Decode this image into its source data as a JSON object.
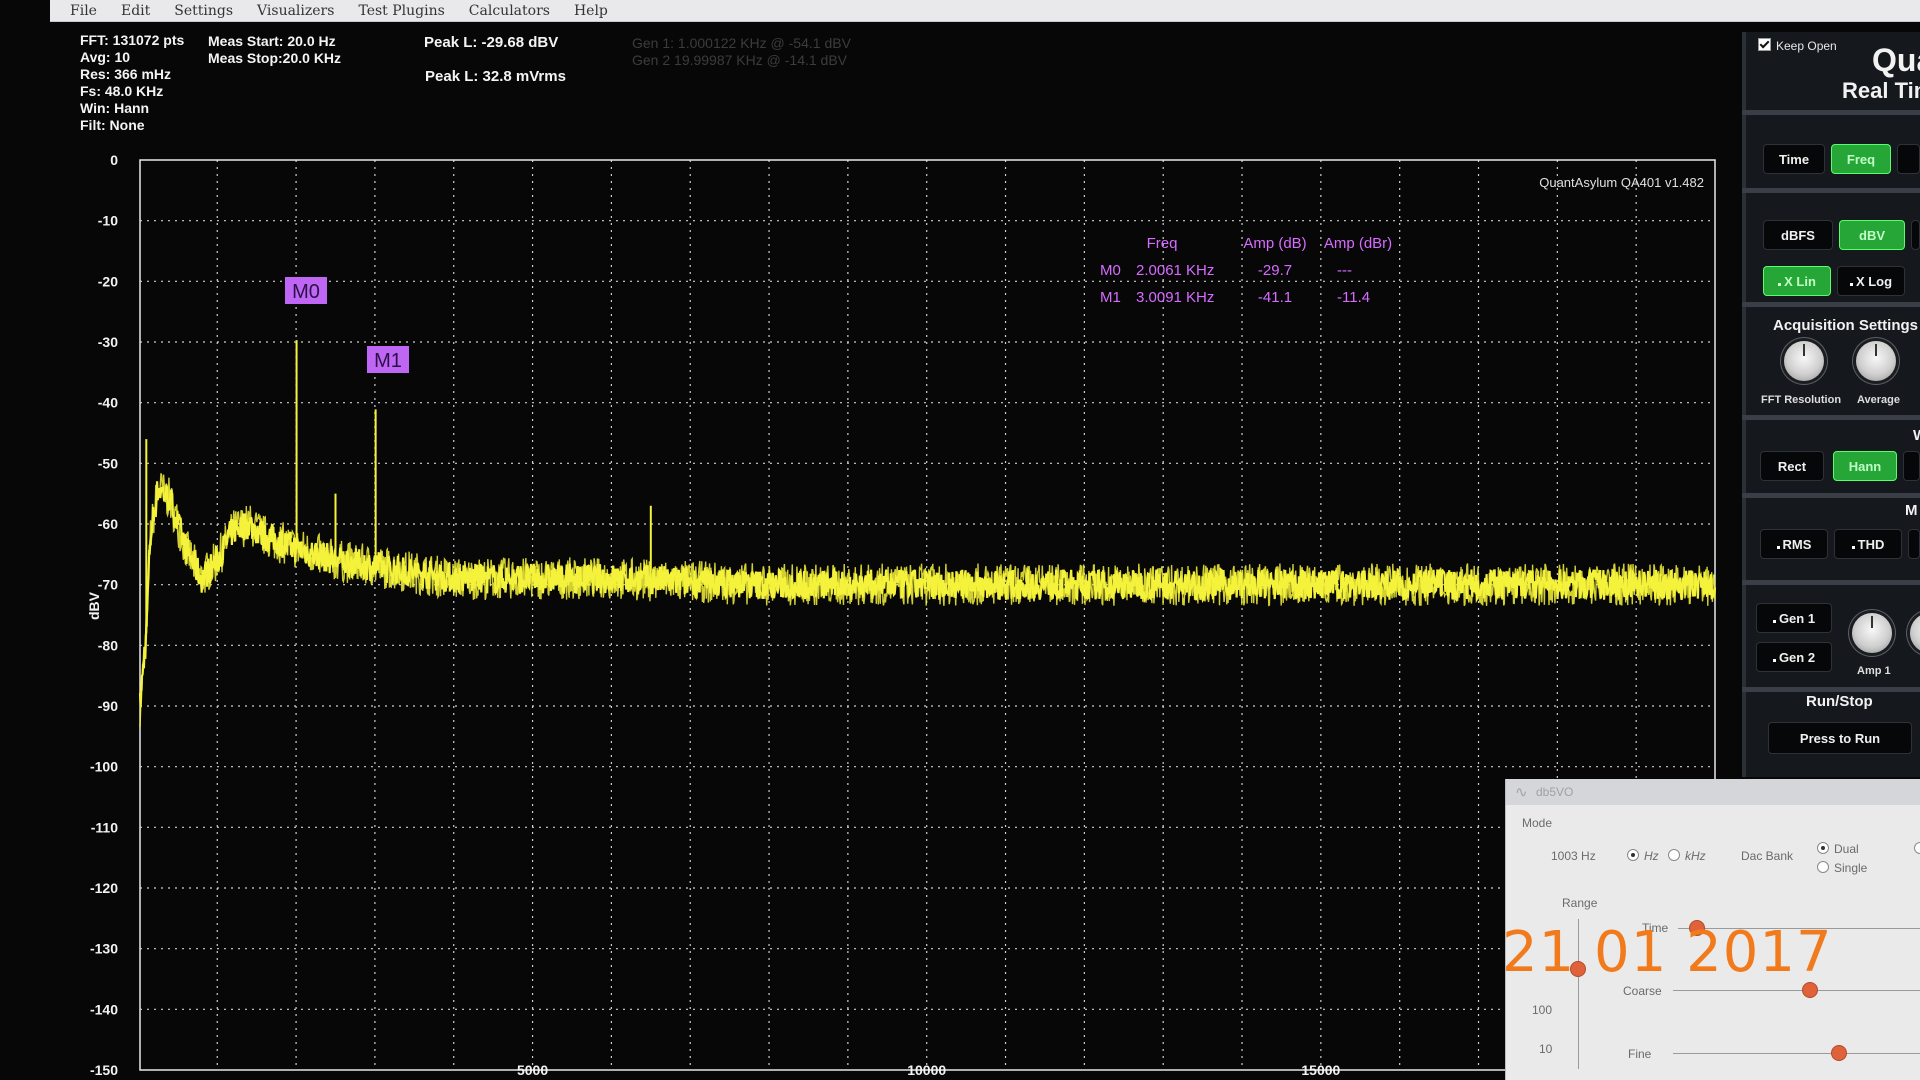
{
  "menu": [
    "File",
    "Edit",
    "Settings",
    "Visualizers",
    "Test Plugins",
    "Calculators",
    "Help"
  ],
  "status": {
    "fft": "FFT: 131072 pts",
    "avg": "Avg: 10",
    "res": "Res: 366 mHz",
    "fs": "Fs: 48.0 KHz",
    "win": "Win: Hann",
    "filt": "Filt: None",
    "meas_start": "Meas Start: 20.0 Hz",
    "meas_stop": "Meas Stop:20.0 KHz",
    "peak_dbv": "Peak L: -29.68 dBV",
    "peak_mvrms": "Peak L: 32.8 mVrms",
    "gen1": "Gen 1: 1.000122 KHz @ -54.1  dBV",
    "gen2": "Gen 2 19.99987 KHz @ -14.1  dBV"
  },
  "plot": {
    "watermark": "QuantAsylum QA401 v1.482",
    "ylabel": "dBV",
    "y_ticks": [
      "0",
      "-10",
      "-20",
      "-30",
      "-40",
      "-50",
      "-60",
      "-70",
      "-80",
      "-90",
      "-100",
      "-110",
      "-120",
      "-130",
      "-140",
      "-150"
    ],
    "x_ticks": [
      "5000",
      "10000",
      "15000"
    ]
  },
  "markers": {
    "headers": {
      "freq": "Freq",
      "amp_db": "Amp (dB)",
      "amp_dbr": "Amp (dBr)"
    },
    "rows": [
      {
        "id": "M0",
        "freq": "2.0061 KHz",
        "amp_db": "-29.7",
        "amp_dbr": "---"
      },
      {
        "id": "M1",
        "freq": "3.0091 KHz",
        "amp_db": "-41.1",
        "amp_dbr": "-11.4"
      }
    ],
    "color": "#c066f5"
  },
  "chart_data": {
    "type": "line",
    "ylabel": "dBV",
    "xlim": [
      20,
      20000
    ],
    "ylim": [
      -150,
      0
    ],
    "grid": true,
    "series": [
      {
        "x": [
          20,
          100,
          150,
          250,
          400,
          600,
          800,
          1000,
          1200,
          1400,
          1600,
          1800,
          2000,
          2500,
          3000,
          3500,
          4000,
          5000,
          6000,
          8000,
          10000,
          12000,
          15000,
          17000,
          20000
        ],
        "values": [
          -90,
          -78,
          -62,
          -54,
          -56,
          -64,
          -69,
          -66,
          -61,
          -60,
          -62,
          -63,
          -64,
          -66,
          -67,
          -68,
          -69,
          -69,
          -69,
          -70,
          -70,
          -70,
          -70,
          -70,
          -70
        ],
        "color": "#f4f23a"
      }
    ],
    "spikes": [
      {
        "x": 2006.1,
        "value": -29.7
      },
      {
        "x": 3009.1,
        "value": -41.1
      },
      {
        "x": 2500,
        "value": -55
      },
      {
        "x": 100,
        "value": -46
      },
      {
        "x": 6500,
        "value": -57
      }
    ]
  },
  "panel": {
    "keep_open": "Keep Open",
    "brand1": "Qua",
    "brand2": "Real Tim",
    "btn_time": "Time",
    "btn_freq": "Freq",
    "btn_dbfs": "dBFS",
    "btn_dbv": "dBV",
    "btn_xlin": "X Lin",
    "btn_xlog": "X Log",
    "acq_title": "Acquisition Settings",
    "knob_fft": "FFT Resolution",
    "knob_avg": "Average",
    "sec_w": "W",
    "btn_rect": "Rect",
    "btn_hann": "Hann",
    "sec_m": "M",
    "btn_rms": "RMS",
    "btn_thd": "THD",
    "btn_gen1": "Gen 1",
    "btn_gen2": "Gen 2",
    "knob_amp1": "Amp 1",
    "runstop_title": "Run/Stop",
    "btn_run": "Press to Run",
    "accent_green": "#27a638"
  },
  "dialog": {
    "title": "db5VO",
    "mode_label": "Mode",
    "freq_value": "1003 Hz",
    "unit_hz": "Hz",
    "unit_khz": "kHz",
    "dac_bank": "Dac Bank",
    "opt_dual": "Dual",
    "opt_single": "Single",
    "range_label": "Range",
    "time_label": "Time",
    "coarse_label": "Coarse",
    "fine_label": "Fine",
    "scale_100": "100",
    "scale_10": "10"
  },
  "date_stamp": "21  01  2017"
}
